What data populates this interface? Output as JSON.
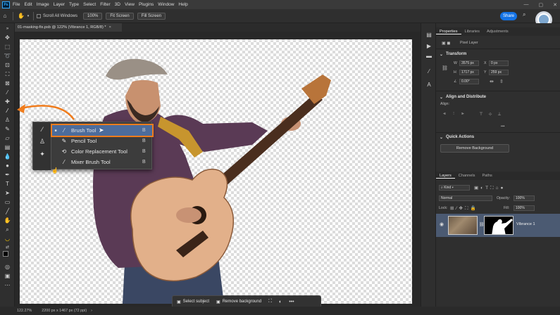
{
  "app": {
    "logo": "Ps",
    "menu": [
      "File",
      "Edit",
      "Image",
      "Layer",
      "Type",
      "Select",
      "Filter",
      "3D",
      "View",
      "Plugins",
      "Window",
      "Help"
    ],
    "window_controls": [
      "—",
      "▢",
      "✕"
    ]
  },
  "options_bar": {
    "scroll_all_windows": "Scroll All Windows",
    "zoom_100": "100%",
    "fit_screen": "Fit Screen",
    "fill_screen": "Fill Screen",
    "share": "Share"
  },
  "document": {
    "tab_title": "01-masking-fix.psb @ 122% (Vibrance 1, RGB/8) *",
    "close": "×"
  },
  "flyout": {
    "items": [
      {
        "label": "Brush Tool",
        "key": "B",
        "icon": "brush-icon",
        "selected": true
      },
      {
        "label": "Pencil Tool",
        "key": "B",
        "icon": "pencil-icon",
        "selected": false
      },
      {
        "label": "Color Replacement Tool",
        "key": "B",
        "icon": "color-replacement-icon",
        "selected": false
      },
      {
        "label": "Mixer Brush Tool",
        "key": "B",
        "icon": "mixer-brush-icon",
        "selected": false
      }
    ],
    "highlight_color": "#f07c1c"
  },
  "properties": {
    "tabs": [
      "Properties",
      "Libraries",
      "Adjustments"
    ],
    "layer_type": "Pixel Layer",
    "transform": {
      "heading": "Transform",
      "w": "3575 px",
      "x": "0 px",
      "h": "1717 px",
      "y": "259 px",
      "angle": "0.00°"
    },
    "align": {
      "heading": "Align and Distribute",
      "label": "Align:",
      "more": "•••"
    },
    "quick_actions": {
      "heading": "Quick Actions",
      "remove_bg": "Remove Background"
    }
  },
  "layers": {
    "tabs": [
      "Layers",
      "Channels",
      "Paths"
    ],
    "filter_kind": "Kind",
    "blend_mode": "Normal",
    "opacity_label": "Opacity:",
    "opacity": "100%",
    "lock_label": "Lock:",
    "fill_label": "Fill:",
    "fill": "100%",
    "layer_name": "Vibrance 1"
  },
  "status": {
    "zoom": "122.27%",
    "doc_size": "2200 px x 1467 px (72 ppi)"
  },
  "contextual_bar": {
    "select_subject": "Select subject",
    "remove_background": "Remove background",
    "more": "•••"
  },
  "colors": {
    "accent": "#1473e6",
    "highlight": "#f07c1c",
    "selected_row": "#4c6c9c"
  }
}
